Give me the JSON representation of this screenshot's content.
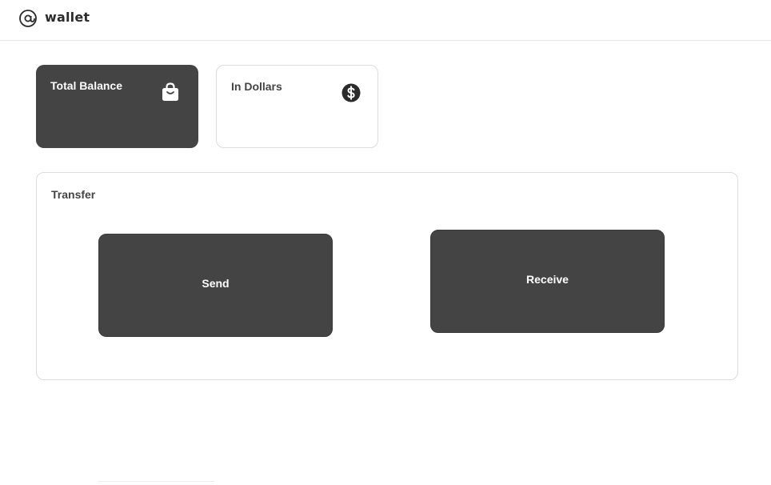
{
  "header": {
    "logo_icon": "at-sign-icon",
    "brand": "wallet"
  },
  "cards": {
    "total_balance": {
      "title": "Total Balance",
      "icon": "shopping-bag-icon"
    },
    "in_dollars": {
      "title": "In Dollars",
      "icon": "dollar-circle-icon"
    }
  },
  "transfer": {
    "title": "Transfer",
    "send_label": "Send",
    "receive_label": "Receive"
  },
  "colors": {
    "dark_card": "#444444",
    "border": "#dcdcdc",
    "background": "#ffffff"
  }
}
